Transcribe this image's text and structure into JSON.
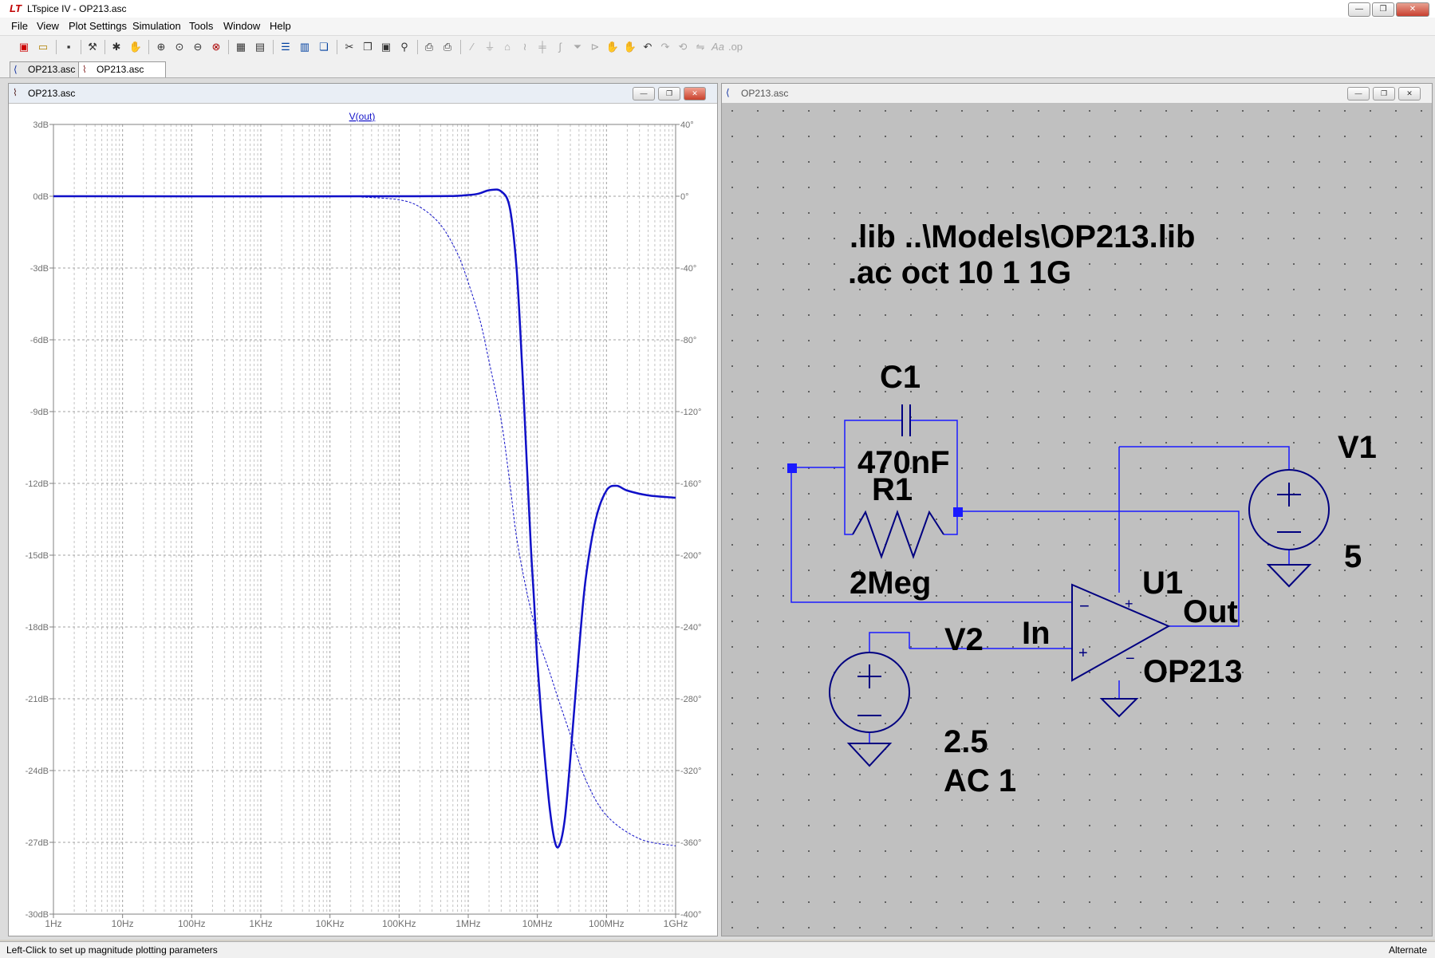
{
  "app": {
    "title": "LTspice IV - OP213.asc"
  },
  "menu": [
    "File",
    "View",
    "Plot Settings",
    "Simulation",
    "Tools",
    "Window",
    "Help"
  ],
  "tabs": [
    {
      "label": "OP213.asc",
      "icon": "schematic-icon",
      "active": false
    },
    {
      "label": "OP213.asc",
      "icon": "waveform-icon",
      "active": true
    }
  ],
  "plot_window": {
    "title": "OP213.asc",
    "chart_data": {
      "type": "line",
      "title": "V(out)",
      "x_scale": "log",
      "x_range_hz": [
        1,
        1000000000
      ],
      "x_tick_labels": [
        "1Hz",
        "10Hz",
        "100Hz",
        "1KHz",
        "10KHz",
        "100KHz",
        "1MHz",
        "10MHz",
        "100MHz",
        "1GHz"
      ],
      "y_left_range_db": [
        -30,
        3
      ],
      "y_left_tick_labels": [
        "3dB",
        "0dB",
        "-3dB",
        "-6dB",
        "-9dB",
        "-12dB",
        "-15dB",
        "-18dB",
        "-21dB",
        "-24dB",
        "-27dB",
        "-30dB"
      ],
      "y_right_range_deg": [
        -400,
        40
      ],
      "y_right_tick_labels": [
        "40°",
        "0°",
        "-40°",
        "-80°",
        "-120°",
        "-160°",
        "-200°",
        "-240°",
        "-280°",
        "-320°",
        "-360°",
        "-400°"
      ],
      "grid": true,
      "series": [
        {
          "name": "V(out)",
          "style": "solid",
          "color": "#1010c8",
          "points": [
            [
              1,
              0
            ],
            [
              100000,
              0
            ],
            [
              1000000,
              0.05
            ],
            [
              2000000,
              0.25
            ],
            [
              3000000,
              0.2
            ],
            [
              4000000,
              -0.5
            ],
            [
              5000000,
              -3
            ],
            [
              6000000,
              -7
            ],
            [
              7000000,
              -11
            ],
            [
              8000000,
              -14.5
            ],
            [
              9000000,
              -17
            ],
            [
              10000000,
              -19.5
            ],
            [
              12000000,
              -22.5
            ],
            [
              15000000,
              -25.5
            ],
            [
              18000000,
              -27
            ],
            [
              21000000,
              -27.1
            ],
            [
              25000000,
              -26
            ],
            [
              30000000,
              -23.5
            ],
            [
              40000000,
              -19
            ],
            [
              50000000,
              -16
            ],
            [
              70000000,
              -13.5
            ],
            [
              100000000,
              -12.3
            ],
            [
              140000000,
              -12.1
            ],
            [
              200000000,
              -12.3
            ],
            [
              400000000,
              -12.5
            ],
            [
              1000000000,
              -12.6
            ]
          ]
        },
        {
          "name": "Phase",
          "style": "dashed",
          "color": "#1010c8",
          "points": [
            [
              1,
              0
            ],
            [
              10000,
              0
            ],
            [
              30000,
              -0.5
            ],
            [
              100000,
              -2
            ],
            [
              200000,
              -6
            ],
            [
              400000,
              -16
            ],
            [
              700000,
              -32
            ],
            [
              1000000,
              -48
            ],
            [
              1500000,
              -70
            ],
            [
              2000000,
              -92
            ],
            [
              3000000,
              -125
            ],
            [
              4000000,
              -160
            ],
            [
              5000000,
              -190
            ],
            [
              7000000,
              -220
            ],
            [
              10000000,
              -245
            ],
            [
              15000000,
              -265
            ],
            [
              20000000,
              -280
            ],
            [
              30000000,
              -300
            ],
            [
              50000000,
              -325
            ],
            [
              100000000,
              -345
            ],
            [
              300000000,
              -358
            ],
            [
              1000000000,
              -362
            ]
          ]
        }
      ]
    }
  },
  "schematic_window": {
    "title": "OP213.asc",
    "directives": [
      ".lib ..\\Models\\OP213.lib",
      ".ac oct 10 1 1G"
    ],
    "labels": {
      "c1_name": "C1",
      "c1_value": "470nF",
      "r1_name": "R1",
      "r1_value": "2Meg",
      "v1_name": "V1",
      "v1_value": "5",
      "v2_name": "V2",
      "v2_value": "2.5",
      "v2_ac": "AC 1",
      "u1_name": "U1",
      "u1_value": "OP213",
      "net_in": "In",
      "net_out": "Out",
      "plus": "+",
      "minus": "−"
    }
  },
  "status": {
    "text": "Left-Click to set up magnitude plotting parameters",
    "mode": "Alternate"
  }
}
